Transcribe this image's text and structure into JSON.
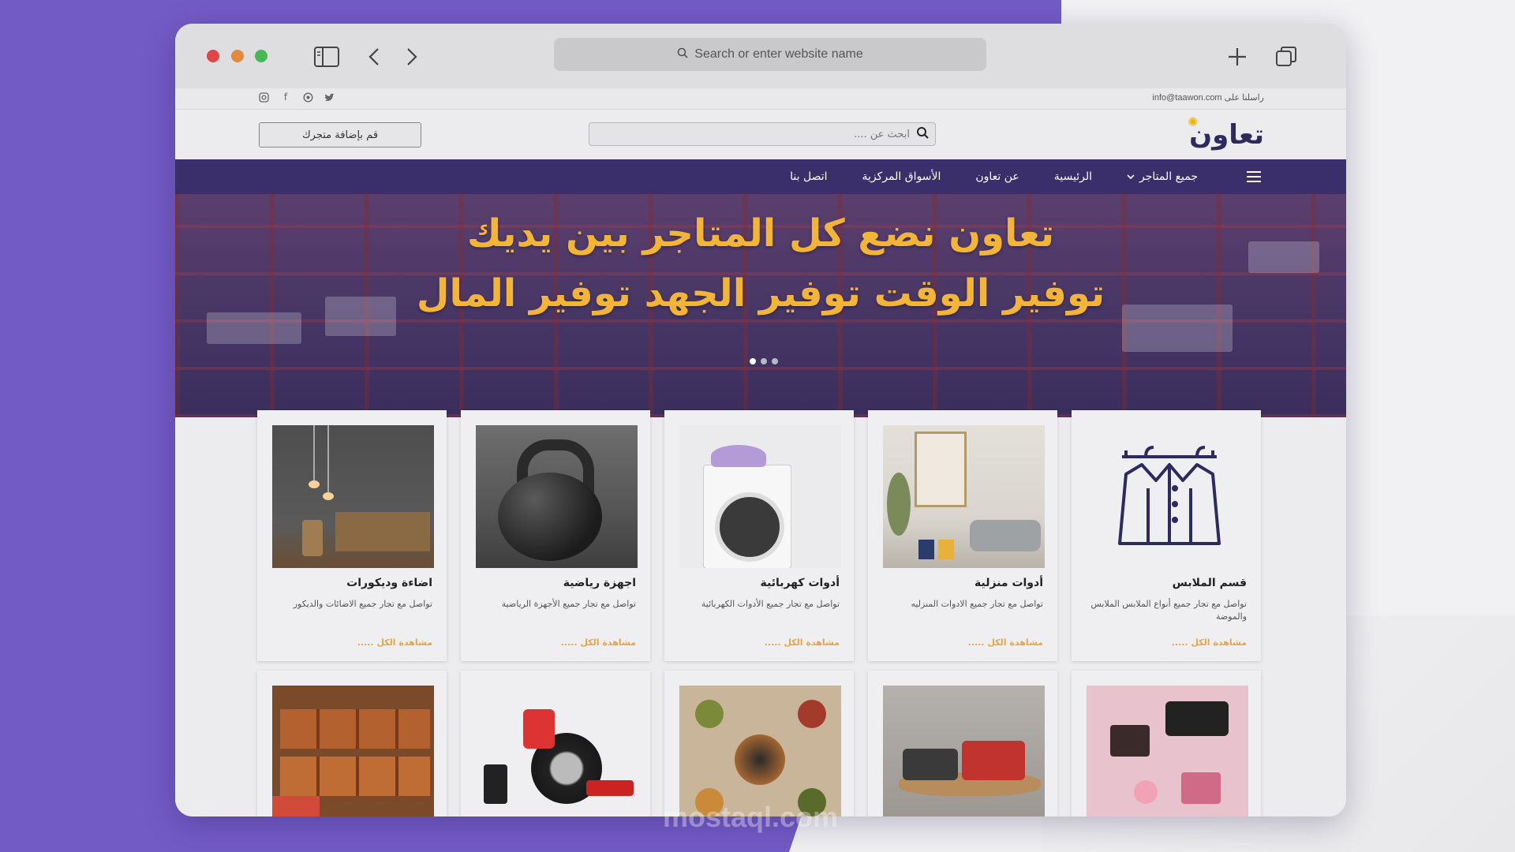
{
  "browser": {
    "address_placeholder": "Search or enter website name"
  },
  "topbar": {
    "email_text": "راسلنا على info@taawon.com",
    "social_icons": [
      "instagram-icon",
      "facebook-icon",
      "whatsapp-icon",
      "twitter-icon"
    ]
  },
  "header": {
    "logo_text": "تعاون",
    "search_placeholder": "ابحث عن ....",
    "add_store_label": "قم بإضافة متجرك"
  },
  "nav": {
    "items": [
      {
        "label": "جميع المتاجر",
        "has_dropdown": true
      },
      {
        "label": "الرئيسية"
      },
      {
        "label": "عن تعاون"
      },
      {
        "label": "الأسواق المركزية"
      },
      {
        "label": "اتصل بنا"
      }
    ]
  },
  "hero": {
    "line1": "تعاون نضع كل المتاجر بين يديك",
    "line2": "توفير الوقت توفير الجهد توفير المال",
    "slides": 3,
    "active_slide": 1
  },
  "categories": [
    {
      "title": "قسم الملابس",
      "desc": "تواصل مع تجار جميع أنواع الملابس الملابس والموضة",
      "more": "مشاهدة الكل .....",
      "image": "clothes-icon"
    },
    {
      "title": "أدوات منزلية",
      "desc": "تواصل مع تجار جميع الادوات المنزليه",
      "more": "مشاهدة الكل .....",
      "image": "living-room"
    },
    {
      "title": "أدوات كهربائية",
      "desc": "تواصل مع تجار جميع الأدوات الكهربائية",
      "more": "مشاهدة الكل .....",
      "image": "washing-machine"
    },
    {
      "title": "اجهزة رياضية",
      "desc": "تواصل مع تجار جميع الأجهزة الرياضية",
      "more": "مشاهدة الكل .....",
      "image": "kettlebell"
    },
    {
      "title": "اضاءة وديكورات",
      "desc": "تواصل مع تجار جميع الاضائات والديكور",
      "more": "مشاهدة الكل .....",
      "image": "lamps-decor"
    }
  ],
  "second_row": [
    "cosmetics",
    "toy-truck",
    "spices",
    "car-parts",
    "bricks"
  ],
  "watermark": "mostaql.com",
  "colors": {
    "background_purple": "#735bc6",
    "nav_purple": "#3b2f6b",
    "hero_text": "#f2b53a",
    "link_orange": "#e3a548",
    "logo": "#2f2a5e"
  }
}
